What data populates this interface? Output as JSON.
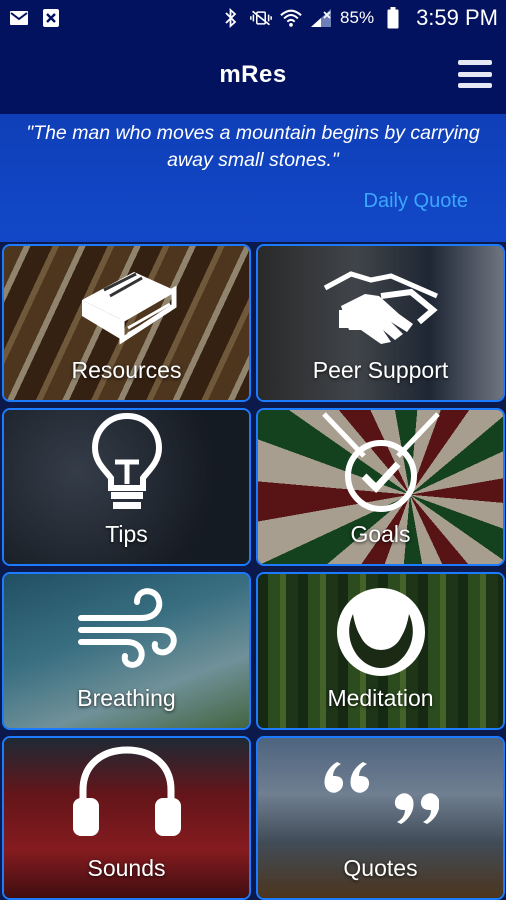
{
  "status_bar": {
    "battery_percent": "85%",
    "time": "3:59 PM"
  },
  "app_bar": {
    "title": "mRes"
  },
  "quote": {
    "text": "\"The man who moves a mountain begins by carrying away small stones.\"",
    "link_label": "Daily Quote"
  },
  "tiles": [
    {
      "label": "Resources",
      "icon": "book-icon"
    },
    {
      "label": "Peer Support",
      "icon": "handshake-icon"
    },
    {
      "label": "Tips",
      "icon": "lightbulb-icon"
    },
    {
      "label": "Goals",
      "icon": "target-check-icon"
    },
    {
      "label": "Breathing",
      "icon": "wind-icon"
    },
    {
      "label": "Meditation",
      "icon": "meditation-icon"
    },
    {
      "label": "Sounds",
      "icon": "headphones-icon"
    },
    {
      "label": "Quotes",
      "icon": "quote-marks-icon"
    }
  ],
  "colors": {
    "header": "#03125e",
    "banner": "#1248c8",
    "accent_link": "#3ba7ff",
    "tile_border": "#1c7bff"
  }
}
